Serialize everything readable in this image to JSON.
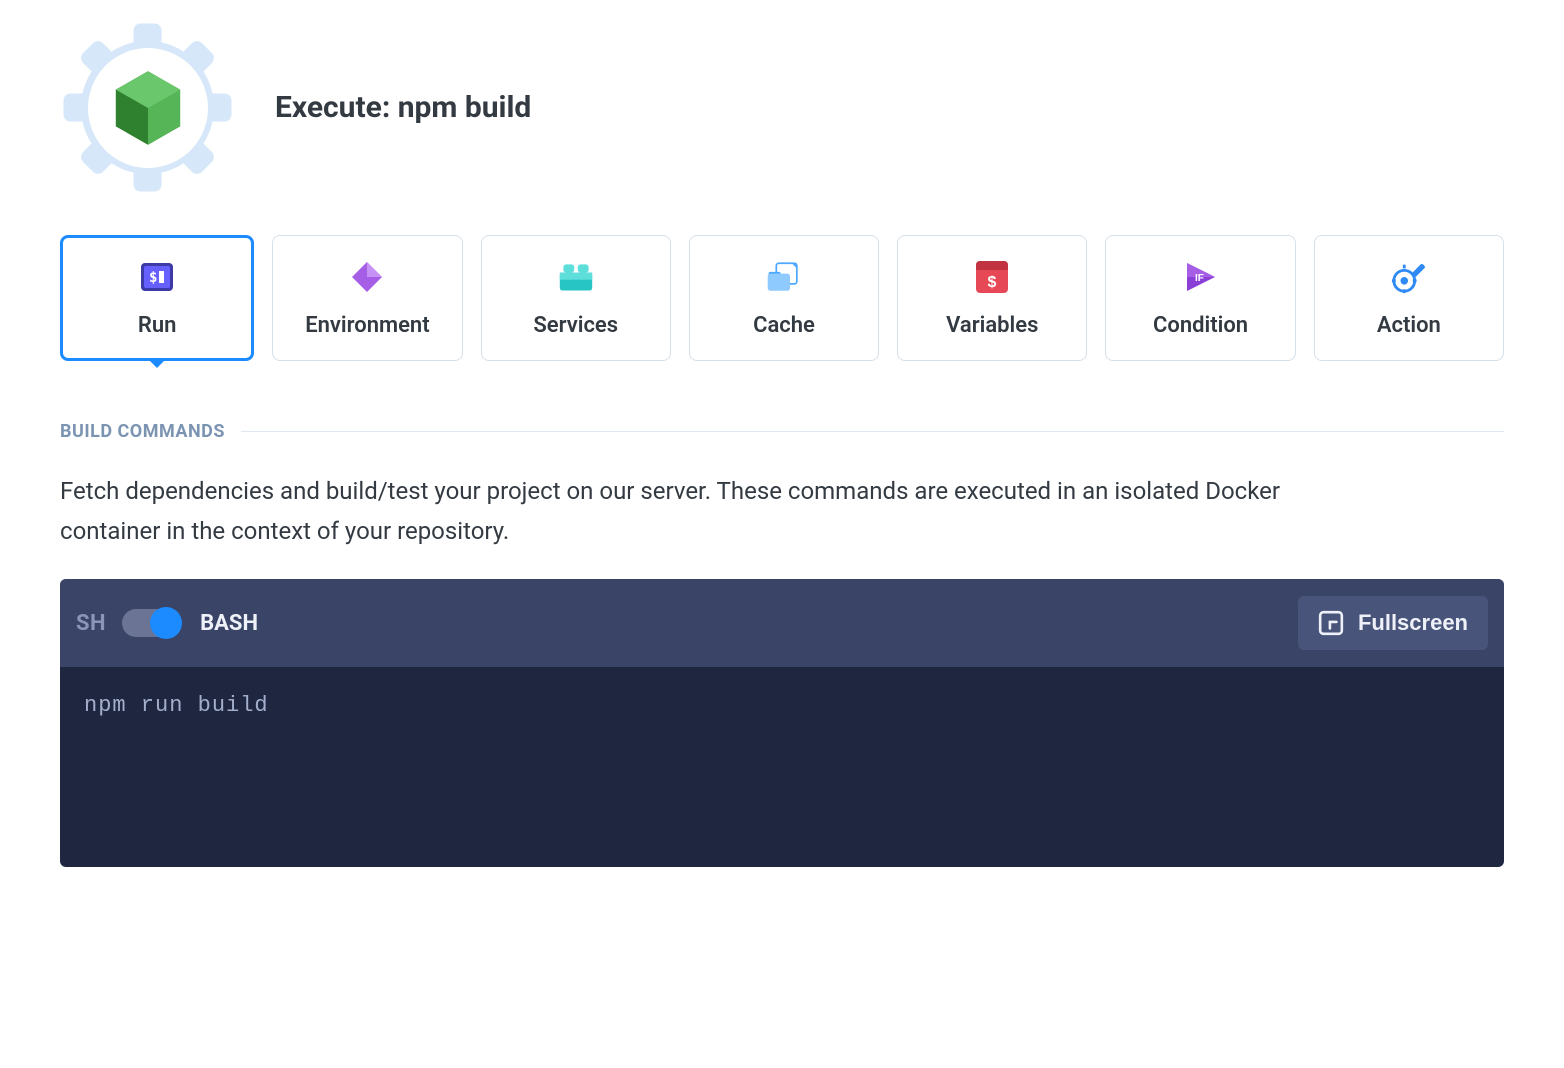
{
  "header": {
    "title": "Execute: npm build"
  },
  "tabs": [
    {
      "id": "run",
      "label": "Run",
      "active": true
    },
    {
      "id": "environment",
      "label": "Environment",
      "active": false
    },
    {
      "id": "services",
      "label": "Services",
      "active": false
    },
    {
      "id": "cache",
      "label": "Cache",
      "active": false
    },
    {
      "id": "variables",
      "label": "Variables",
      "active": false
    },
    {
      "id": "condition",
      "label": "Condition",
      "active": false
    },
    {
      "id": "action",
      "label": "Action",
      "active": false
    }
  ],
  "section": {
    "label": "BUILD COMMANDS",
    "description": "Fetch dependencies and build/test your project on our server. These commands are executed in an isolated Docker container in the context of your repository."
  },
  "editor": {
    "shell_left": "SH",
    "shell_right": "BASH",
    "fullscreen_label": "Fullscreen",
    "content": "npm run build"
  }
}
